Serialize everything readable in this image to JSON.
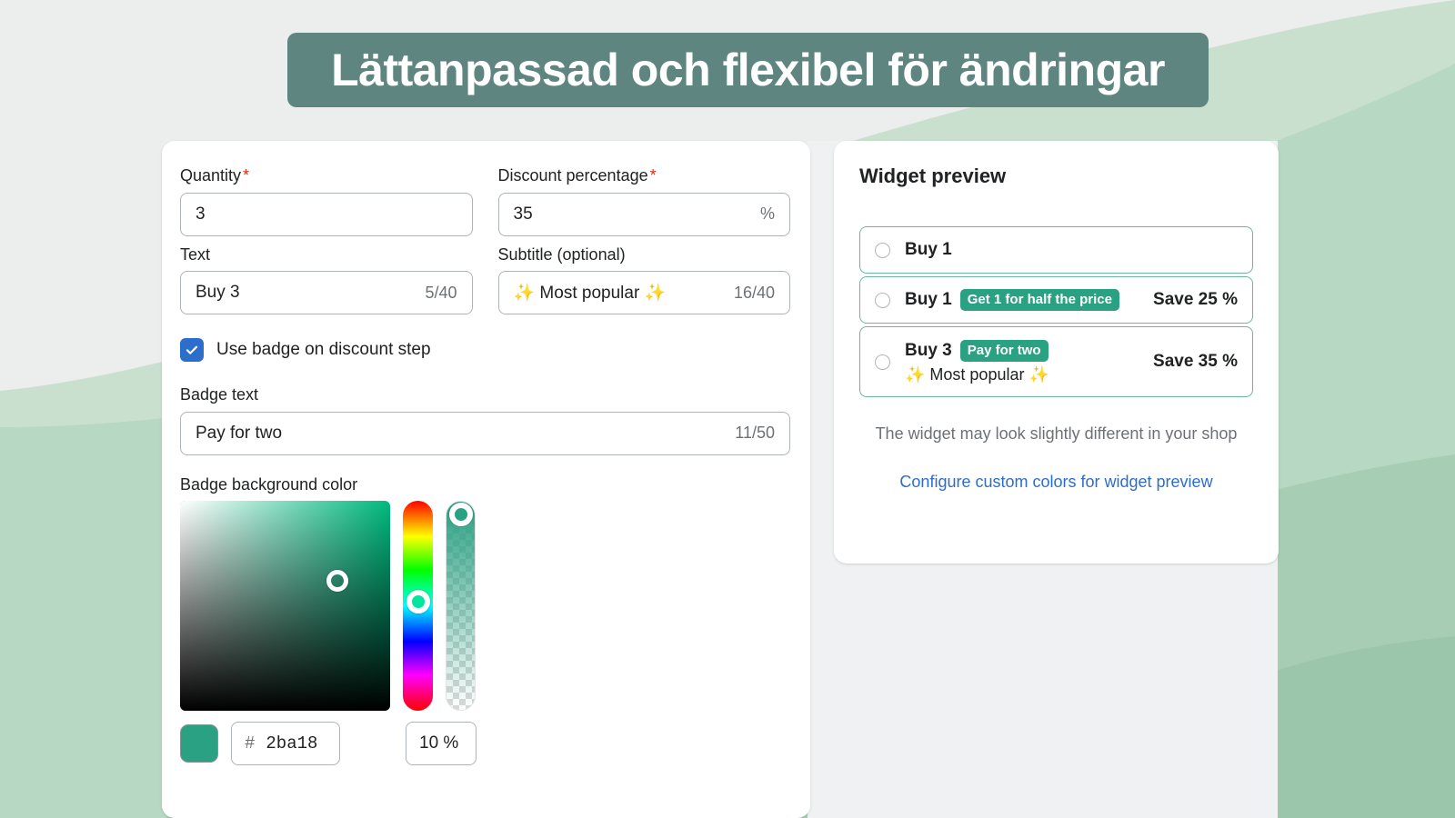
{
  "banner": {
    "text": "Lättanpassad och flexibel för ändringar",
    "background_color": "#5f8580",
    "text_color": "#ffffff"
  },
  "form": {
    "quantity": {
      "label": "Quantity",
      "required_marker": "*",
      "value": "3"
    },
    "discount_percentage": {
      "label": "Discount percentage",
      "required_marker": "*",
      "value": "35",
      "suffix": "%"
    },
    "text": {
      "label": "Text",
      "value": "Buy 3",
      "counter": "5/40"
    },
    "subtitle": {
      "label": "Subtitle (optional)",
      "value": "✨ Most popular ✨",
      "counter": "16/40"
    },
    "use_badge_checkbox": {
      "label": "Use badge on discount step",
      "checked": true,
      "accent_color": "#2c6ecb"
    },
    "badge_text": {
      "label": "Badge text",
      "value": "Pay for two",
      "counter": "11/50"
    },
    "badge_background_color": {
      "label": "Badge background color",
      "hash_symbol": "#",
      "hex_value": "2ba18",
      "opacity_value": "10 %",
      "swatch_color": "#2ba183"
    }
  },
  "preview": {
    "title": "Widget preview",
    "offers": [
      {
        "title": "Buy 1",
        "badge": "",
        "subtitle": "",
        "save": ""
      },
      {
        "title": "Buy 1",
        "badge": "Get 1 for half the price",
        "subtitle": "",
        "save": "Save 25 %"
      },
      {
        "title": "Buy 3",
        "badge": "Pay for two",
        "subtitle": "✨ Most popular ✨",
        "save": "Save 35 %"
      }
    ],
    "note": "The widget may look slightly different in your shop",
    "link": "Configure custom colors for widget preview",
    "link_color": "#2c6ecb",
    "badge_color": "#2ba183",
    "row_border_color": "#6ab79d"
  }
}
